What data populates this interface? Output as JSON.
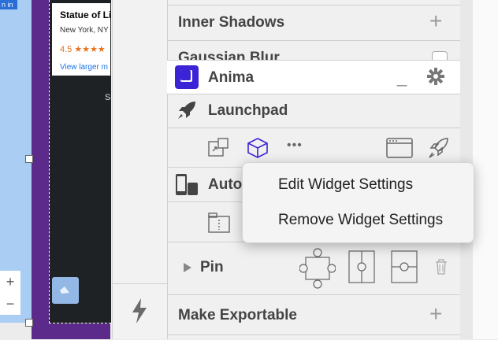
{
  "canvas": {
    "map_signin": "n in",
    "place_card": {
      "title": "Statue of Li",
      "address": "New York, NY",
      "rating": "4.5 ★★★★",
      "link": "View larger m"
    },
    "artboard_letter": "S",
    "zoom_in": "+",
    "zoom_out": "−"
  },
  "panel": {
    "inner_shadows": {
      "label": "Inner Shadows",
      "add": "+"
    },
    "gaussian_blur": {
      "label": "Gaussian Blur"
    },
    "anima": {
      "label": "Anima",
      "minimize": "_"
    },
    "launchpad": {
      "label": "Launchpad",
      "more": "•••"
    },
    "auto": {
      "label": "Auto"
    },
    "pin": {
      "label": "Pin"
    },
    "make_exportable": {
      "label": "Make Exportable",
      "add": "+"
    }
  },
  "context_menu": {
    "items": [
      "Edit Widget Settings",
      "Remove Widget Settings"
    ]
  },
  "colors": {
    "anima_accent": "#3b24d6",
    "canvas_purple": "#5b2a8a",
    "map_blue": "#a9cdf3"
  },
  "icons": [
    "gear-icon",
    "rocket-icon",
    "cube-icon",
    "lightning-icon",
    "trash-icon",
    "phone-tablet-icon",
    "browser-window-icon",
    "disclosure-triangle-icon"
  ]
}
